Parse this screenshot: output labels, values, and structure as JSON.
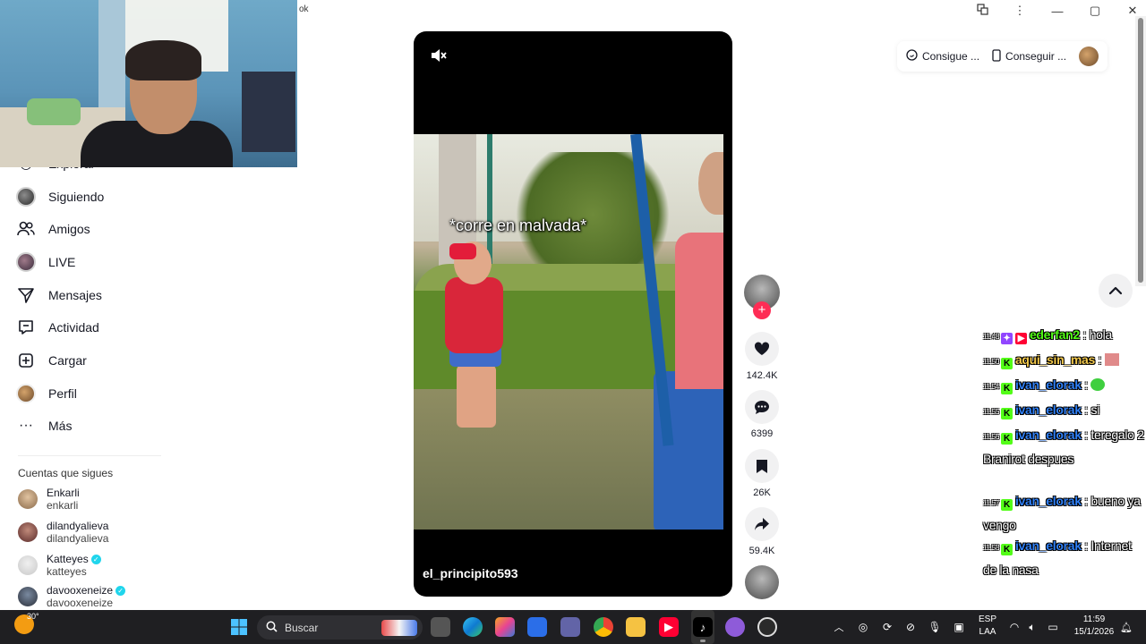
{
  "browser": {
    "tab_fragment": "ok",
    "controls": {
      "translate_icon": "translate-icon",
      "menu_icon": "more-vertical-icon",
      "minimize": "—",
      "maximize": "▢",
      "close": "✕"
    }
  },
  "sidebar": {
    "partial_item": "Explorar",
    "items": [
      {
        "label": "Siguiendo",
        "icon": "following-avatar-icon"
      },
      {
        "label": "Amigos",
        "icon": "friends-icon"
      },
      {
        "label": "LIVE",
        "icon": "live-avatar-icon"
      },
      {
        "label": "Mensajes",
        "icon": "send-icon"
      },
      {
        "label": "Actividad",
        "icon": "inbox-icon"
      },
      {
        "label": "Cargar",
        "icon": "upload-icon"
      },
      {
        "label": "Perfil",
        "icon": "profile-avatar-icon"
      },
      {
        "label": "Más",
        "icon": "more-horizontal-icon"
      }
    ],
    "following_title": "Cuentas que sigues",
    "following": [
      {
        "name": "Enkarli",
        "handle": "enkarli",
        "verified": false
      },
      {
        "name": "dilandyalieva",
        "handle": "dilandyalieva",
        "verified": false
      },
      {
        "name": "Katteyes",
        "handle": "katteyes",
        "verified": true
      },
      {
        "name": "davooxeneize",
        "handle": "davooxeneize",
        "verified": true
      }
    ]
  },
  "video": {
    "caption_overlay": "*corre en malvada*",
    "author": "el_principito593",
    "muted": true
  },
  "actions": {
    "likes": "142.4K",
    "comments": "6399",
    "saves": "26K",
    "shares": "59.4K"
  },
  "top_right": {
    "coins_label": "Consigue ...",
    "app_label": "Conseguir ..."
  },
  "chat": [
    {
      "time": "11:48",
      "badges": [
        "tw",
        "yt"
      ],
      "user": "ederfan2",
      "color": "green",
      "text": "hola"
    },
    {
      "time": "11:50",
      "badges": [
        "k"
      ],
      "user": "aqui_sin_mas",
      "color": "gold",
      "text": "",
      "emote": "emote-red"
    },
    {
      "time": "11:54",
      "badges": [
        "k"
      ],
      "user": "ivan_elorak",
      "color": "blue",
      "text": "",
      "emote": "emote-green"
    },
    {
      "time": "11:55",
      "badges": [
        "k"
      ],
      "user": "ivan_elorak",
      "color": "blue",
      "text": "si"
    },
    {
      "time": "11:56",
      "badges": [
        "k"
      ],
      "user": "ivan_elorak",
      "color": "blue",
      "text": "teregalo 2 Branirot despues"
    },
    {
      "time": "11:57",
      "badges": [
        "k"
      ],
      "user": "ivan_elorak",
      "color": "blue",
      "text": "bueno ya vengo"
    },
    {
      "time": "11:58",
      "badges": [
        "k"
      ],
      "user": "ivan_elorak",
      "color": "blue",
      "text": "Internet de la nasa"
    }
  ],
  "taskbar": {
    "temperature": "30°",
    "search_placeholder": "Buscar",
    "language_line1": "ESP",
    "language_line2": "LAA",
    "time": "11:59",
    "date": "15/1/2026"
  }
}
